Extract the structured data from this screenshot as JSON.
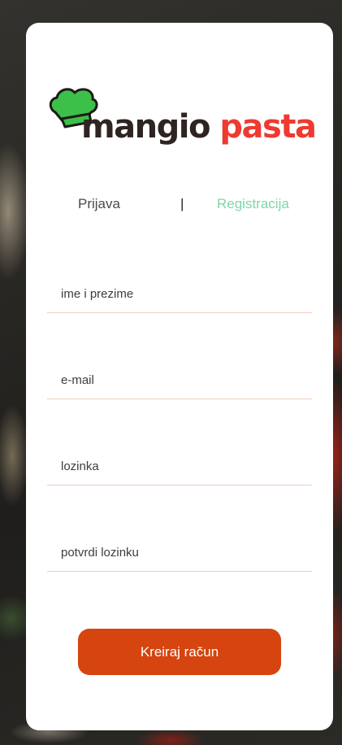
{
  "brand": {
    "word1": "mangio",
    "word2": "pasta",
    "icon": "chef-hat-icon",
    "colors": {
      "dark": "#2e2422",
      "red": "#ee3a30",
      "hat_green": "#3cc04a"
    }
  },
  "tabs": {
    "login_label": "Prijava",
    "separator": "|",
    "register_label": "Registracija",
    "active": "register",
    "active_color": "#7fd6a6"
  },
  "form": {
    "fields": [
      {
        "name": "full-name",
        "placeholder": "ime i prezime",
        "value": ""
      },
      {
        "name": "email",
        "placeholder": "e-mail",
        "value": ""
      },
      {
        "name": "password",
        "placeholder": "lozinka",
        "value": ""
      },
      {
        "name": "confirm-password",
        "placeholder": "potvrdi lozinku",
        "value": ""
      }
    ],
    "submit_label": "Kreiraj račun",
    "submit_color": "#d6440f"
  }
}
